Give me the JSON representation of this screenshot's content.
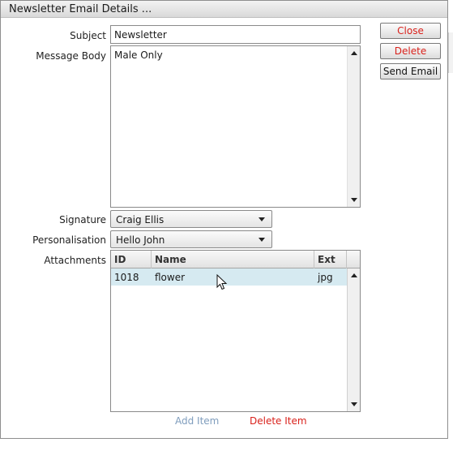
{
  "window": {
    "title": "Newsletter Email Details ..."
  },
  "form": {
    "subject_label": "Subject",
    "subject_value": "Newsletter",
    "message_label": "Message Body",
    "message_value": "Male Only",
    "signature_label": "Signature",
    "signature_value": "Craig Ellis",
    "personalisation_label": "Personalisation",
    "personalisation_value": "Hello John",
    "attachments_label": "Attachments"
  },
  "buttons": {
    "close": "Close",
    "delete": "Delete",
    "send": "Send Email"
  },
  "attachments": {
    "columns": {
      "id": "ID",
      "name": "Name",
      "ext": "Ext"
    },
    "rows": [
      {
        "id": "1018",
        "name": "flower",
        "ext": "jpg"
      }
    ]
  },
  "actions": {
    "add_item": "Add Item",
    "delete_item": "Delete Item"
  },
  "colors": {
    "danger": "#d9211b",
    "disabled_link": "#7f9dbd",
    "selected_row": "#d6eaf1"
  }
}
